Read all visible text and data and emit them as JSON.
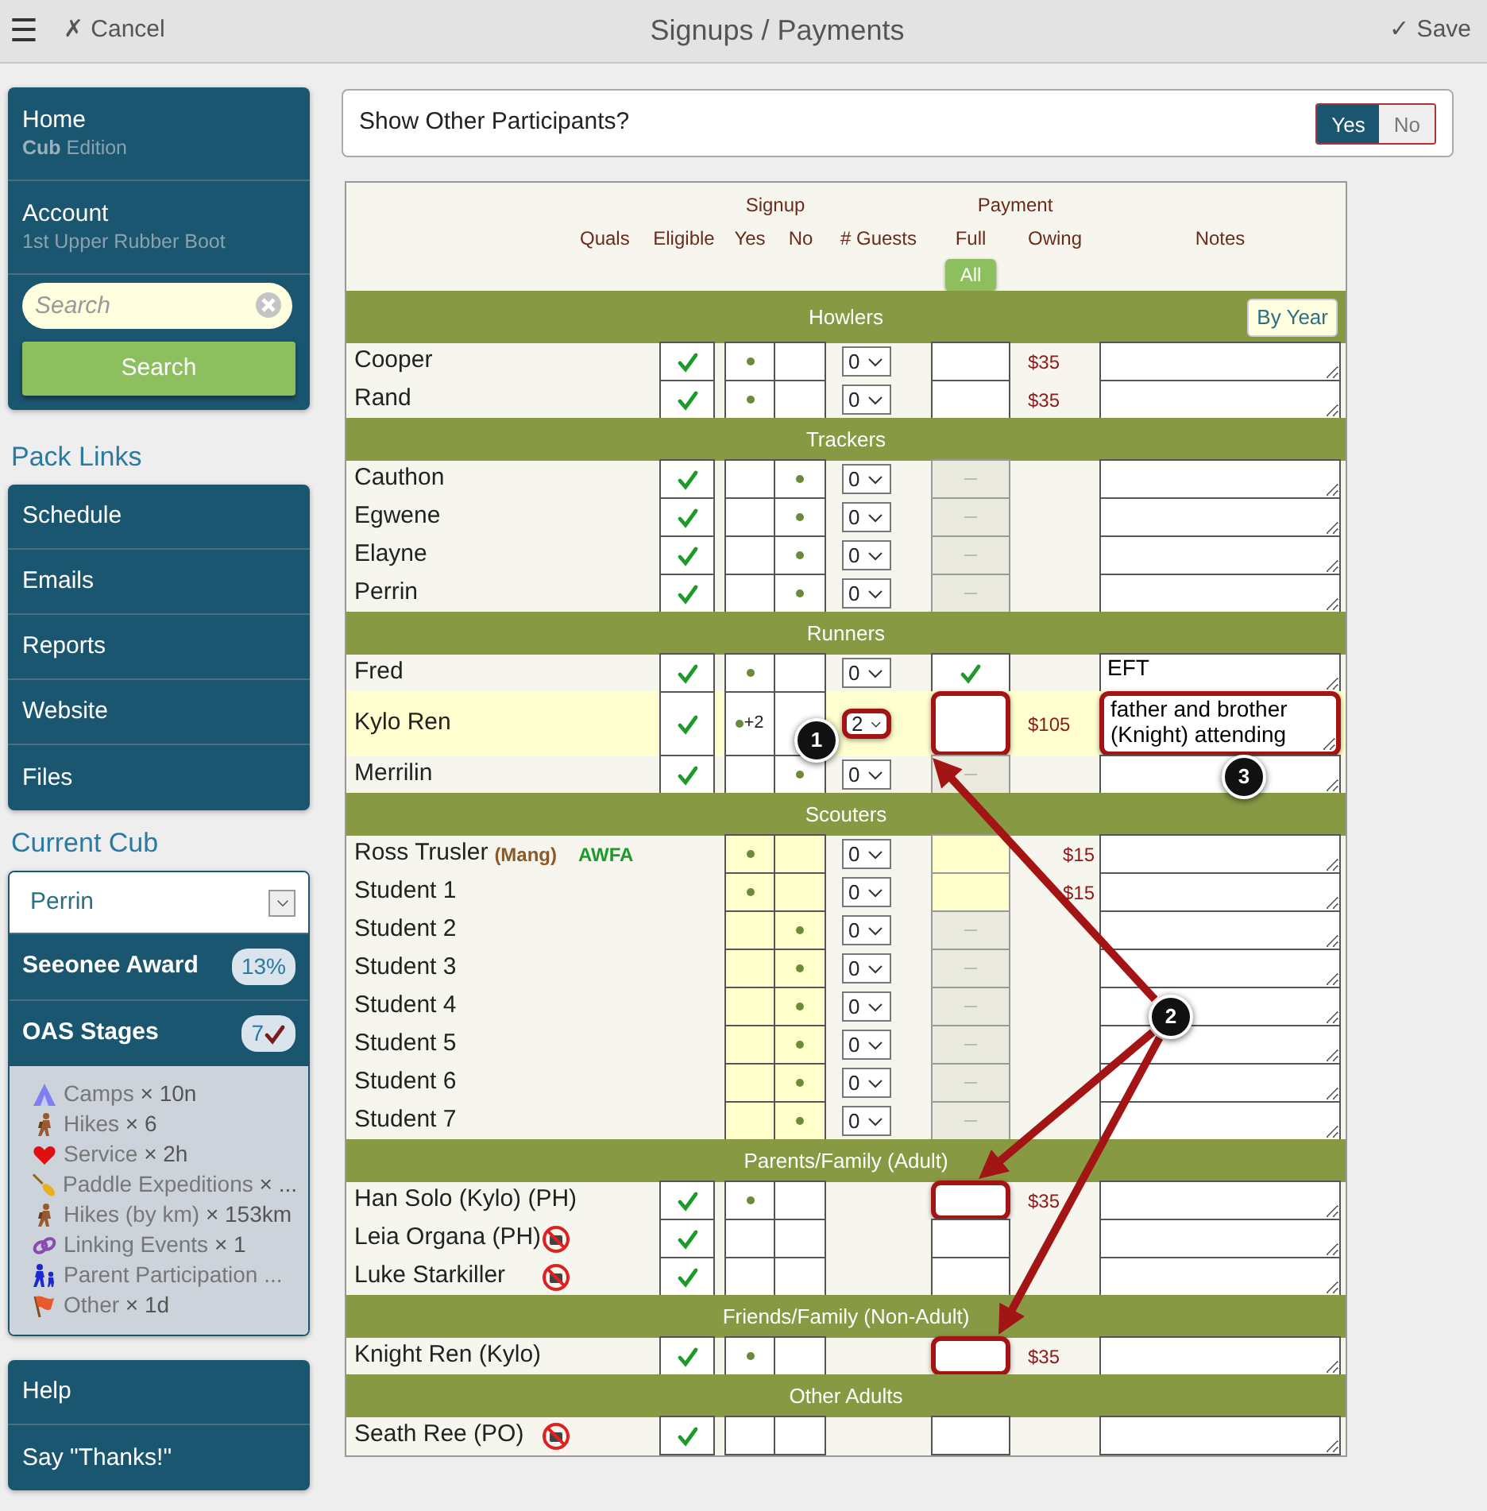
{
  "top_bar": {
    "menu": "☰",
    "cancel": "✗ Cancel",
    "title": "Signups / Payments",
    "save": "✓ Save"
  },
  "sidebar": {
    "main_menu": [
      {
        "label": "Home",
        "sub": "**Cub** Edition"
      },
      {
        "label": "Account",
        "sub": "1st Upper Rubber Boot"
      }
    ],
    "search": {
      "placeholder": "Search",
      "button": "Search"
    },
    "pack_links_title": "Pack Links",
    "pack_links": [
      "Schedule",
      "Emails",
      "Reports",
      "Website",
      "Files"
    ],
    "current_cub_title": "Current Cub",
    "current_cub": {
      "select": "Perrin",
      "awards": [
        {
          "label": "Seeonee Award",
          "badge": "13%",
          "checked": false
        },
        {
          "label": "OAS Stages",
          "badge": "7",
          "checked": true
        }
      ],
      "stages": [
        {
          "kind": "tent",
          "label": "Camps",
          "value": "× 10n"
        },
        {
          "kind": "hiker",
          "label": "Hikes",
          "value": "× 6"
        },
        {
          "kind": "heart",
          "label": "Service",
          "value": "× 2h"
        },
        {
          "kind": "paddle",
          "label": "Paddle Expeditions",
          "value": "× ..."
        },
        {
          "kind": "hiker",
          "label": "Hikes (by km)",
          "value": "× 153km"
        },
        {
          "kind": "link",
          "label": "Linking Events",
          "value": "× 1"
        },
        {
          "kind": "family",
          "label": "Parent Participation ..."
        },
        {
          "kind": "flag",
          "label": "Other",
          "value": "× 1d"
        }
      ]
    },
    "bottom_menu": [
      "Help",
      "Say \"Thanks!\""
    ]
  },
  "participants": {
    "label": "Show Other Participants?",
    "options": [
      {
        "label": "Yes",
        "selected": true
      },
      {
        "label": "No",
        "selected": false
      }
    ]
  },
  "table": {
    "group_headers": {
      "signup": "Signup",
      "payment": "Payment"
    },
    "columns": {
      "quals": "Quals",
      "eligible": "Eligible",
      "yes": "Yes",
      "no": "No",
      "guests": "# Guests",
      "full": "Full",
      "owing": "Owing",
      "notes": "Notes"
    },
    "all_button": "All",
    "sections": [
      {
        "title": "Howlers",
        "kind": "cub",
        "button": "By Year",
        "rows": [
          {
            "name": "Cooper",
            "eligible": true,
            "signed_yes": true,
            "signed_no": false,
            "guests": "0",
            "paid": false,
            "payment_disabled": false,
            "payment_due": false,
            "owing": "$35",
            "highlighted": false
          },
          {
            "name": "Rand",
            "eligible": true,
            "signed_yes": true,
            "signed_no": false,
            "guests": "0",
            "paid": false,
            "payment_disabled": false,
            "payment_due": false,
            "owing": "$35",
            "highlighted": false
          }
        ]
      },
      {
        "title": "Trackers",
        "kind": "cub",
        "rows": [
          {
            "name": "Cauthon",
            "eligible": true,
            "signed_yes": false,
            "signed_no": true,
            "guests": "0",
            "paid": false,
            "payment_disabled": true,
            "payment_due": false,
            "highlighted": false
          },
          {
            "name": "Egwene",
            "eligible": true,
            "signed_yes": false,
            "signed_no": true,
            "guests": "0",
            "paid": false,
            "payment_disabled": true,
            "payment_due": false,
            "highlighted": false
          },
          {
            "name": "Elayne",
            "eligible": true,
            "signed_yes": false,
            "signed_no": true,
            "guests": "0",
            "paid": false,
            "payment_disabled": true,
            "payment_due": false,
            "highlighted": false
          },
          {
            "name": "Perrin",
            "eligible": true,
            "signed_yes": false,
            "signed_no": true,
            "guests": "0",
            "paid": false,
            "payment_disabled": true,
            "payment_due": false,
            "highlighted": false
          }
        ]
      },
      {
        "title": "Runners",
        "kind": "cub",
        "rows": [
          {
            "name": "Fred",
            "eligible": true,
            "signed_yes": true,
            "signed_no": false,
            "guests": "0",
            "paid": true,
            "payment_disabled": false,
            "payment_due": false,
            "notes": "EFT",
            "highlighted": false
          },
          {
            "name": "Kylo Ren",
            "eligible": true,
            "signed_yes": true,
            "signed_no": false,
            "signup_extra": "+2",
            "guests": "2",
            "paid": false,
            "payment_disabled": false,
            "payment_due": false,
            "owing": "$105",
            "notes": "father and brother (Knight) attending",
            "highlighted": true,
            "boxed": {
              "guests": true,
              "full": true,
              "notes": true
            },
            "callout_guests": "1",
            "callout_notes": "3"
          },
          {
            "name": "Merrilin",
            "eligible": true,
            "signed_yes": false,
            "signed_no": true,
            "guests": "0",
            "paid": false,
            "payment_disabled": true,
            "payment_due": false,
            "highlighted": false
          }
        ]
      },
      {
        "title": "Scouters",
        "kind": "scouter",
        "rows": [
          {
            "name": "Ross Trusler",
            "tag": "(Mang)",
            "qual": "AWFA",
            "signed_yes": true,
            "signed_no": false,
            "guests": "0",
            "paid": false,
            "payment_disabled": false,
            "payment_due": true,
            "owing": "$15",
            "highlighted": false
          },
          {
            "name": "Student 1",
            "signed_yes": true,
            "signed_no": false,
            "guests": "0",
            "paid": false,
            "payment_disabled": false,
            "payment_due": true,
            "owing": "$15",
            "highlighted": false
          },
          {
            "name": "Student 2",
            "signed_yes": false,
            "signed_no": true,
            "guests": "0",
            "paid": false,
            "payment_disabled": true,
            "payment_due": false,
            "highlighted": false
          },
          {
            "name": "Student 3",
            "signed_yes": false,
            "signed_no": true,
            "guests": "0",
            "paid": false,
            "payment_disabled": true,
            "payment_due": false,
            "highlighted": false
          },
          {
            "name": "Student 4",
            "signed_yes": false,
            "signed_no": true,
            "guests": "0",
            "paid": false,
            "payment_disabled": true,
            "payment_due": false,
            "highlighted": false,
            "callout_notes": "2",
            "callout_arrows": true
          },
          {
            "name": "Student 5",
            "signed_yes": false,
            "signed_no": true,
            "guests": "0",
            "paid": false,
            "payment_disabled": true,
            "payment_due": false,
            "highlighted": false
          },
          {
            "name": "Student 6",
            "signed_yes": false,
            "signed_no": true,
            "guests": "0",
            "paid": false,
            "payment_disabled": true,
            "payment_due": false,
            "highlighted": false
          },
          {
            "name": "Student 7",
            "signed_yes": false,
            "signed_no": true,
            "guests": "0",
            "paid": false,
            "payment_disabled": true,
            "payment_due": false,
            "highlighted": false
          }
        ]
      },
      {
        "title": "Parents/Family (Adult)",
        "kind": "adult",
        "rows": [
          {
            "name": "Han Solo (Kylo) (PH)",
            "no_photo": false,
            "eligible": true,
            "signed_yes": true,
            "signed_no": false,
            "paid": false,
            "payment_disabled": false,
            "payment_due": false,
            "owing": "$35",
            "highlighted": false,
            "boxed": {
              "full": true
            }
          },
          {
            "name": "Leia Organa (PH)",
            "no_photo": true,
            "eligible": true,
            "signed_yes": false,
            "signed_no": false,
            "paid": false,
            "payment_disabled": false,
            "payment_due": false,
            "highlighted": false
          },
          {
            "name": "Luke Starkiller",
            "no_photo": true,
            "eligible": true,
            "signed_yes": false,
            "signed_no": false,
            "paid": false,
            "payment_disabled": false,
            "payment_due": false,
            "highlighted": false
          }
        ]
      },
      {
        "title": "Friends/Family (Non-Adult)",
        "kind": "adult",
        "rows": [
          {
            "name": "Knight Ren (Kylo)",
            "eligible": true,
            "signed_yes": true,
            "signed_no": false,
            "paid": false,
            "payment_disabled": false,
            "payment_due": false,
            "owing": "$35",
            "highlighted": false,
            "boxed": {
              "full": true
            }
          }
        ]
      },
      {
        "title": "Other Adults",
        "kind": "adult",
        "rows": [
          {
            "name": "Seath Ree (PO)",
            "no_photo": true,
            "eligible": true,
            "signed_yes": false,
            "signed_no": false,
            "paid": false,
            "payment_disabled": false,
            "payment_due": false,
            "highlighted": false
          }
        ]
      }
    ]
  }
}
